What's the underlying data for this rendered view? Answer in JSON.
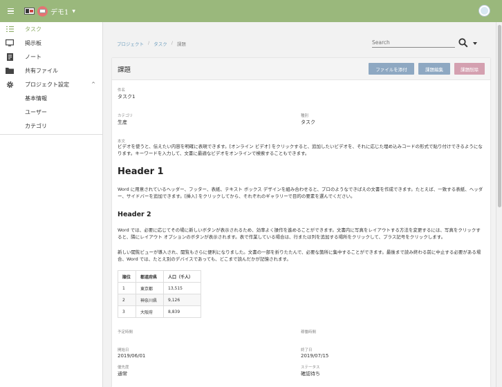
{
  "project": {
    "name": "デモ1"
  },
  "sidebar": {
    "items": [
      {
        "label": "タスク",
        "icon": "checklist-icon"
      },
      {
        "label": "掲示板",
        "icon": "board-icon"
      },
      {
        "label": "ノート",
        "icon": "note-icon"
      },
      {
        "label": "共有ファイル",
        "icon": "folder-icon"
      },
      {
        "label": "プロジェクト設定",
        "icon": "gear-icon"
      }
    ],
    "sub_items": [
      {
        "label": "基本情報"
      },
      {
        "label": "ユーザー"
      },
      {
        "label": "カテゴリ"
      }
    ]
  },
  "breadcrumb": {
    "items": [
      "プロジェクト",
      "タスク",
      "課題"
    ],
    "separator": "/"
  },
  "search": {
    "placeholder": "Search"
  },
  "card": {
    "title": "課題",
    "buttons": {
      "attach": "ファイルを添付",
      "edit": "課題編集",
      "delete": "課題削除"
    },
    "fields": {
      "name": {
        "label": "件名",
        "value": "タスク1"
      },
      "category": {
        "label": "カテゴリ",
        "value": "生産"
      },
      "kind": {
        "label": "種別",
        "value": "タスク"
      },
      "body": {
        "label": "本文"
      },
      "planned_time": {
        "label": "予定時間",
        "value": ""
      },
      "actual_time": {
        "label": "稼働時間",
        "value": ""
      },
      "start_date": {
        "label": "開始日",
        "value": "2019/06/01"
      },
      "end_date": {
        "label": "終了日",
        "value": "2019/07/15"
      },
      "priority": {
        "label": "優先度",
        "value": "通常"
      },
      "status": {
        "label": "ステータス",
        "value": "確認待ち"
      }
    },
    "content": {
      "intro": "ビデオを使うと、伝えたい内容を明確に表現できます。[オンライン ビデオ] をクリックすると、追加したいビデオを、それに応じた埋め込みコードの形式で貼り付けできるようになります。キーワードを入力して、文書に最適なビデオをオンラインで検索することもできます。",
      "h1": "Header 1",
      "p1": "Word に用意されているヘッダー、フッター、表紙、テキスト ボックス デザインを組み合わせると、プロのようなできばえの文書を作成できます。たとえば、一致する表紙、ヘッダー、サイドバーを追加できます。[挿入] をクリックしてから、それぞれのギャラリーで目的の要素を選んでください。",
      "h2": "Header 2",
      "p2": "Word では、必要に応じてその場に新しいボタンが表示されるため、効率よく操作を進めることができます。文書内に写真をレイアウトする方法を変更するには、写真をクリックすると、隣にレイアウト オプションのボタンが表示されます。表で作業している場合は、行または列を追加する場所をクリックして、プラス記号をクリックします。",
      "p3": "新しい閲覧ビューが導入され、閲覧もさらに便利になりました。文書の一部を折りたたんで、必要な箇所に集中することができます。最後まで読み終わる前に中止する必要がある場合、Word では、たとえ別のデバイスであっても、どこまで読んだかが記憶されます。"
    },
    "table": {
      "headers": [
        "順位",
        "都道府県",
        "人口（千人）"
      ],
      "rows": [
        [
          "1",
          "東京都",
          "13,515"
        ],
        [
          "2",
          "神奈川県",
          "9,126"
        ],
        [
          "3",
          "大阪府",
          "8,839"
        ]
      ]
    }
  },
  "colors": {
    "topbar": "#9ab87c",
    "accent": "#8fae6a",
    "button_blue": "#8ea8c2",
    "button_pink": "#d4a0b0",
    "link": "#6f9fbf"
  }
}
